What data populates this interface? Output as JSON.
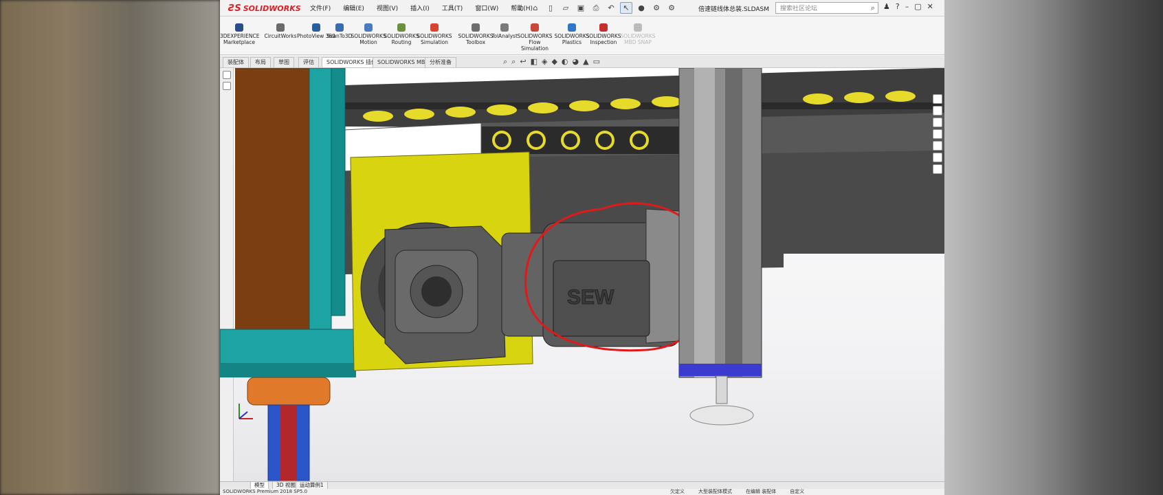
{
  "window": {
    "doc_title": "倍速链线体总装.SLDASM"
  },
  "menu": {
    "items": [
      "文件(F)",
      "编辑(E)",
      "视图(V)",
      "插入(I)",
      "工具(T)",
      "窗口(W)",
      "帮助(H)"
    ]
  },
  "search": {
    "placeholder": "搜索社区论坛"
  },
  "command_manager": {
    "items": [
      {
        "label": "3DEXPERIENCE Marketplace",
        "color": "#2b4e8a"
      },
      {
        "label": "CircuitWorks",
        "color": "#6a6a6a"
      },
      {
        "label": "PhotoView 360",
        "color": "#2a5f9e"
      },
      {
        "label": "ScanTo3D",
        "color": "#3b6bb0"
      },
      {
        "label": "SOLIDWORKS Motion",
        "color": "#4a7bc0"
      },
      {
        "label": "SOLIDWORKS Routing",
        "color": "#6b8f3a"
      },
      {
        "label": "SOLIDWORKS Simulation",
        "color": "#d8432e"
      },
      {
        "label": "SOLIDWORKS Toolbox",
        "color": "#6d6d6d"
      },
      {
        "label": "TolAnalyst",
        "color": "#7a7a7a"
      },
      {
        "label": "SOLIDWORKS Flow Simulation",
        "color": "#c9473a"
      },
      {
        "label": "SOLIDWORKS Plastics",
        "color": "#2f77c4"
      },
      {
        "label": "SOLIDWORKS Inspection",
        "color": "#c62d2d"
      },
      {
        "label": "SOLIDWORKS MBD SNAP",
        "color": "#bcbcbc",
        "disabled": true
      }
    ]
  },
  "tabs": {
    "items": [
      "装配体",
      "布局",
      "草图",
      "评估",
      "SOLIDWORKS 插件",
      "SOLIDWORKS MBD",
      "分析准备"
    ],
    "active_index": 4
  },
  "bottom_tabs": {
    "items": [
      "模型",
      "3D 视图",
      "运动算例1"
    ],
    "active_index": 0
  },
  "status": {
    "left": "SOLIDWORKS Premium 2018 SP5.0",
    "right_items": [
      "欠定义",
      "大型装配体模式",
      "在编辑 装配体",
      "自定义"
    ]
  },
  "annotation": {
    "brand_text": "SEW",
    "circle_color": "#e0191b"
  },
  "colors": {
    "accent": "#d1232a",
    "frame_teal": "#1ea3a3",
    "panel_brown": "#7a3e10",
    "plate_yellow": "#d9d410",
    "gear_gray": "#5b5b5b"
  }
}
